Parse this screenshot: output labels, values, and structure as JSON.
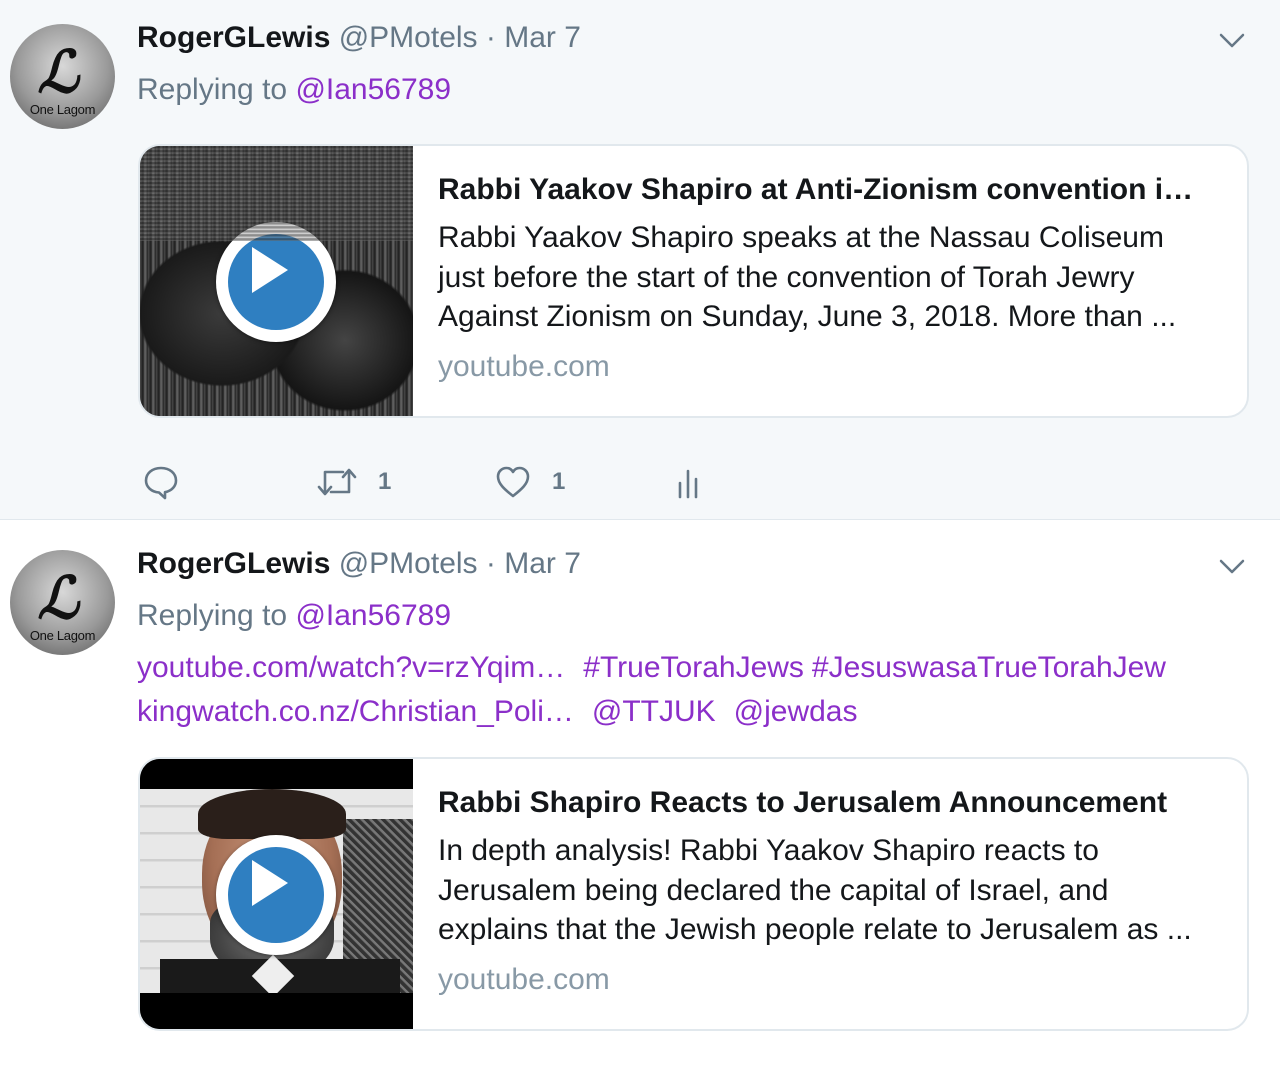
{
  "colors": {
    "link": "#8b2fc9",
    "muted": "#657786",
    "play": "#2f7fc1",
    "background_highlight": "#f5f8fa"
  },
  "tweets": [
    {
      "author": {
        "name": "RogerGLewis",
        "handle": "@PMotels",
        "avatar_caption": "One Lagom",
        "avatar_glyph": "ℒ"
      },
      "separator": "·",
      "date": "Mar 7",
      "reply": {
        "prefix": "Replying to",
        "mention": "@Ian56789"
      },
      "card": {
        "title": "Rabbi Yaakov Shapiro at Anti-Zionism convention i…",
        "description": "Rabbi Yaakov Shapiro speaks at the Nassau Coliseum just before the start of the convention of Torah Jewry Against Zionism on Sunday, June 3, 2018. More than ...",
        "domain": "youtube.com"
      },
      "actions": {
        "reply_icon": "reply-icon",
        "retweet_icon": "retweet-icon",
        "retweet_count": "1",
        "like_icon": "heart-icon",
        "like_count": "1",
        "analytics_icon": "analytics-icon"
      }
    },
    {
      "author": {
        "name": "RogerGLewis",
        "handle": "@PMotels",
        "avatar_caption": "One Lagom",
        "avatar_glyph": "ℒ"
      },
      "separator": "·",
      "date": "Mar 7",
      "reply": {
        "prefix": "Replying to",
        "mention": "@Ian56789"
      },
      "body_line1": {
        "link": "youtube.com/watch?v=rzYqim…",
        "hashtag1": "#TrueTorahJews",
        "hashtag2": "#JesuswasaTrueTorahJew"
      },
      "body_line2": {
        "link": "kingwatch.co.nz/Christian_Poli…",
        "mention1": "@TTJUK",
        "mention2": "@jewdas"
      },
      "card": {
        "title": "Rabbi Shapiro Reacts to Jerusalem Announcement",
        "description": "In depth analysis! Rabbi Yaakov Shapiro reacts to Jerusalem being declared the capital of Israel, and explains that the Jewish people relate to Jerusalem as ...",
        "domain": "youtube.com"
      }
    }
  ]
}
